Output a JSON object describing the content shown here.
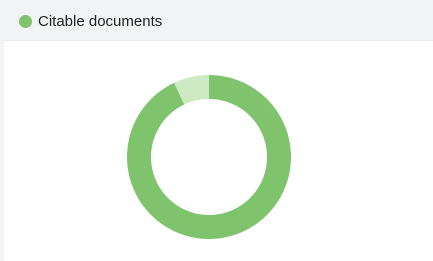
{
  "panel": {
    "title": "Citable documents"
  },
  "colors": {
    "primary": "#7fc46d",
    "secondary": "#cdeac5",
    "header_bg": "#f2f3f5",
    "title_text": "#222222"
  },
  "chart_data": {
    "type": "pie",
    "style": "donut",
    "title": "Citable documents",
    "series": [
      {
        "label": "",
        "value": 93,
        "color": "#7fc46d"
      },
      {
        "label": "",
        "value": 7,
        "color": "#cdeac5"
      }
    ]
  }
}
